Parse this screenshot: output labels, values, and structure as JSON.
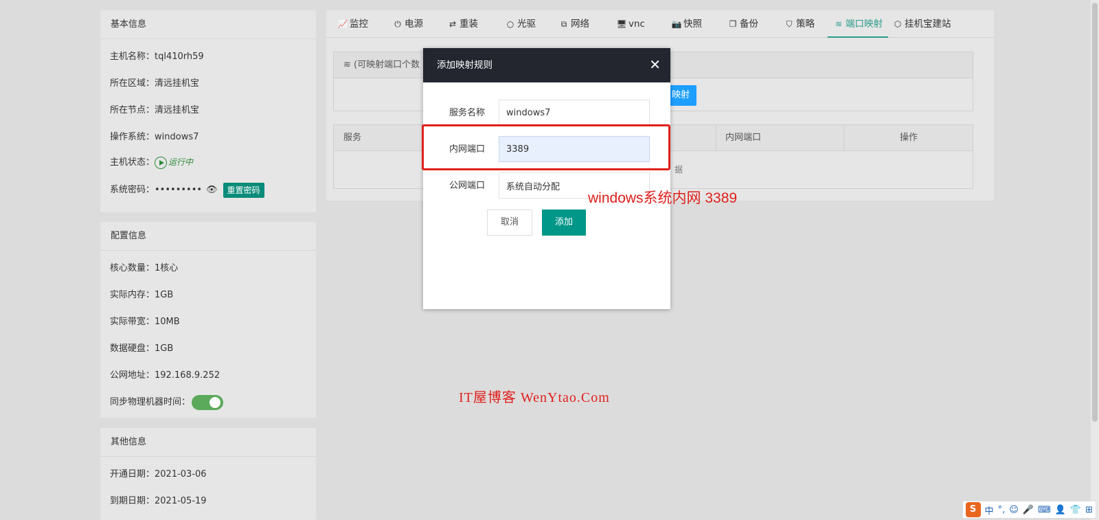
{
  "basic": {
    "title": "基本信息",
    "hostname": "主机名称：tql410rh59",
    "region": "所在区域：清远挂机宝",
    "node": "所在节点：清远挂机宝",
    "os": "操作系统：windows7",
    "status_label": "主机状态：",
    "status_value": "运行中",
    "password_label": "系统密码：",
    "password_value": "•••••••••",
    "reset_btn": "重置密码"
  },
  "config": {
    "title": "配置信息",
    "cores": "核心数量：1核心",
    "memory": "实际内存：1GB",
    "bandwidth": "实际带宽：10MB",
    "disk": "数据硬盘：1GB",
    "ip": "公网地址：192.168.9.252",
    "sync_label": "同步物理机器时间："
  },
  "other": {
    "title": "其他信息",
    "open_date": "开通日期：2021-03-06",
    "expire_date": "到期日期：2021-05-19"
  },
  "tabs": [
    {
      "label": "监控",
      "icon": "chart-line-icon"
    },
    {
      "label": "电源",
      "icon": "power-icon"
    },
    {
      "label": "重装",
      "icon": "retweet-icon"
    },
    {
      "label": "光驱",
      "icon": "disc-icon"
    },
    {
      "label": "网络",
      "icon": "sitemap-icon"
    },
    {
      "label": "vnc",
      "icon": "desktop-icon"
    },
    {
      "label": "快照",
      "icon": "camera-icon"
    },
    {
      "label": "备份",
      "icon": "copy-icon"
    },
    {
      "label": "策略",
      "icon": "shield-icon"
    },
    {
      "label": "端口映射",
      "icon": "wifi-icon"
    },
    {
      "label": "挂机宝建站",
      "icon": "cube-icon"
    }
  ],
  "portmap": {
    "info": "(可映射端口个数",
    "add_btn": "映射",
    "col_service": "服务",
    "col_inner": "内网端口",
    "col_action": "操作",
    "empty_frag": "据"
  },
  "modal": {
    "title": "添加映射规则",
    "service_label": "服务名称",
    "service_value": "windows7",
    "inner_label": "内网端口",
    "inner_value": "3389",
    "public_label": "公网端口",
    "public_value": "系统自动分配",
    "cancel": "取消",
    "add": "添加"
  },
  "annotation": "windows系统内网 3389",
  "watermark": "IT屋博客 WenYtao.Com",
  "ime": {
    "logo": "S",
    "lang": "中",
    "punct": "°,"
  }
}
